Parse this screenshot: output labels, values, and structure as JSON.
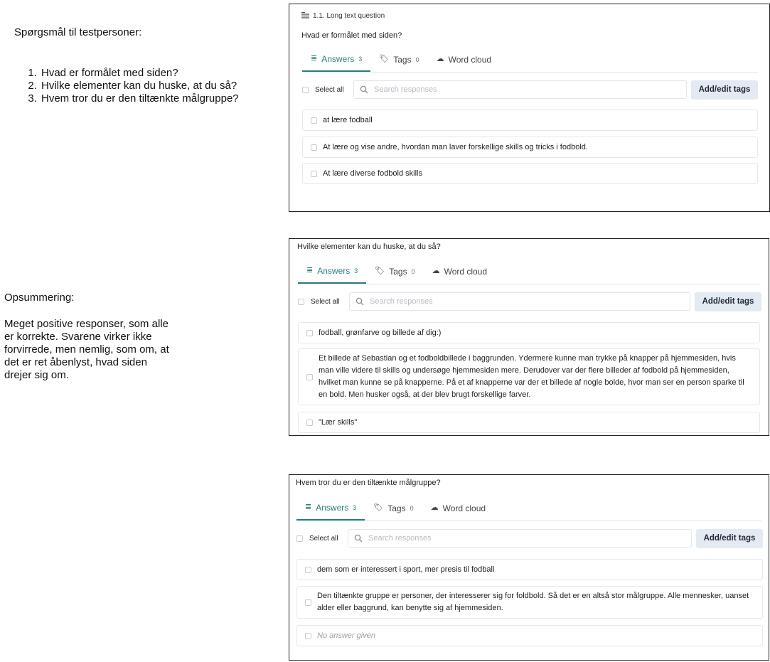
{
  "notes": {
    "questions_title": "Spørgsmål til testpersoner:",
    "questions": [
      "Hvad er formålet med siden?",
      "Hvilke elementer kan du huske, at du så?",
      "Hvem tror du er den tiltænkte målgruppe?"
    ],
    "summary_title": "Opsummering:",
    "summary_text": "Meget positive responser, som alle\ner korrekte. Svarene virker ikke\nforvirrede, men nemlig, som om, at\ndet er ret åbenlyst, hvad siden\ndrejer sig om."
  },
  "colors": {
    "accent": "#2a7d7a",
    "button_bg": "#e4eaf2",
    "border": "#222222"
  },
  "common": {
    "tab_answers": "Answers",
    "tab_tags": "Tags",
    "tab_wordcloud": "Word cloud",
    "select_all": "Select all",
    "search_placeholder": "Search responses",
    "add_edit_tags": "Add/edit tags"
  },
  "panels": [
    {
      "header": "1.1. Long text question",
      "header_icon": "long-text-icon",
      "question": "Hvad er formålet med siden?",
      "answers_count": "3",
      "tags_count": "0",
      "answers": [
        "at lære fodball",
        "At lære og vise andre, hvordan man laver forskellige skills og tricks i fodbold.",
        "At lære diverse fodbold skills"
      ]
    },
    {
      "question": "Hvilke elementer kan du huske, at du så?",
      "answers_count": "3",
      "tags_count": "0",
      "answers": [
        "fodball, grønfarve og billede af dig:)",
        "Et billede af Sebastian og et fodboldbillede i baggrunden. Ydermere kunne man trykke på knapper på hjemmesiden, hvis man ville videre til skills og undersøge hjemmesiden mere. Derudover var der flere billeder af fodbold på hjemmesiden, hvilket man kunne se på knapperne. På et af knapperne var der et billede af nogle bolde, hvor man ser en person sparke til en bold. Men husker også, at der blev brugt forskellige farver.",
        "\"Lær skills\""
      ]
    },
    {
      "question": "Hvem tror du er den tiltænkte målgruppe?",
      "answers_count": "3",
      "tags_count": "0",
      "answers": [
        "dem som er interessert i sport, mer presis til fodball",
        "Den tiltænkte gruppe er personer, der interesserer sig for foldbold. Så det er en altså stor målgruppe. Alle mennesker, uanset alder eller baggrund, kan benytte sig af hjemmesiden.",
        "No answer given"
      ]
    }
  ]
}
